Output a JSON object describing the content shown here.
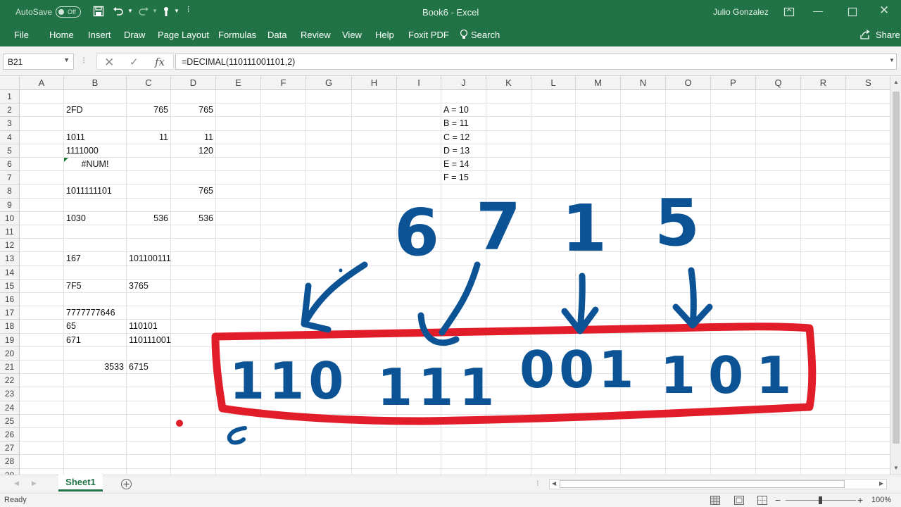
{
  "titlebar": {
    "autosave_label": "AutoSave",
    "autosave_state": "Off",
    "window_title": "Book6 - Excel",
    "user_name": "Julio Gonzalez",
    "bg_color": "#217346"
  },
  "ribbon": {
    "tabs": [
      "File",
      "Home",
      "Insert",
      "Draw",
      "Page Layout",
      "Formulas",
      "Data",
      "Review",
      "View",
      "Help",
      "Foxit PDF"
    ],
    "search_label": "Search",
    "share_label": "Share"
  },
  "formula_bar": {
    "name_box": "B21",
    "formula": "=DECIMAL(110111001101,2)",
    "fx_label": "fx"
  },
  "grid": {
    "columns": [
      "A",
      "B",
      "C",
      "D",
      "E",
      "F",
      "G",
      "H",
      "I",
      "J",
      "K",
      "L",
      "M",
      "N",
      "O",
      "P",
      "Q",
      "R",
      "S"
    ],
    "rows": [
      "1",
      "2",
      "3",
      "4",
      "5",
      "6",
      "7",
      "8",
      "9",
      "10",
      "11",
      "12",
      "13",
      "14",
      "15",
      "16",
      "17",
      "18",
      "19",
      "20",
      "21",
      "22",
      "23",
      "24",
      "25",
      "26",
      "27",
      "28",
      "29"
    ],
    "cells": [
      {
        "col": "B",
        "row": 2,
        "value": "2FD",
        "align": "left"
      },
      {
        "col": "C",
        "row": 2,
        "value": "765",
        "align": "right"
      },
      {
        "col": "D",
        "row": 2,
        "value": "765",
        "align": "right"
      },
      {
        "col": "B",
        "row": 4,
        "value": "1011",
        "align": "left"
      },
      {
        "col": "C",
        "row": 4,
        "value": "11",
        "align": "right"
      },
      {
        "col": "D",
        "row": 4,
        "value": "11",
        "align": "right"
      },
      {
        "col": "B",
        "row": 5,
        "value": "1111000",
        "align": "left"
      },
      {
        "col": "D",
        "row": 5,
        "value": "120",
        "align": "right"
      },
      {
        "col": "B",
        "row": 6,
        "value": "#NUM!",
        "align": "center"
      },
      {
        "col": "B",
        "row": 8,
        "value": "1011111101",
        "align": "left"
      },
      {
        "col": "D",
        "row": 8,
        "value": "765",
        "align": "right"
      },
      {
        "col": "B",
        "row": 10,
        "value": "1030",
        "align": "left"
      },
      {
        "col": "C",
        "row": 10,
        "value": "536",
        "align": "right"
      },
      {
        "col": "D",
        "row": 10,
        "value": "536",
        "align": "right"
      },
      {
        "col": "B",
        "row": 13,
        "value": "167",
        "align": "left"
      },
      {
        "col": "C",
        "row": 13,
        "value": "101100111",
        "align": "left"
      },
      {
        "col": "B",
        "row": 15,
        "value": "7F5",
        "align": "left"
      },
      {
        "col": "C",
        "row": 15,
        "value": "3765",
        "align": "left"
      },
      {
        "col": "B",
        "row": 17,
        "value": "7777777646",
        "align": "left"
      },
      {
        "col": "B",
        "row": 18,
        "value": "65",
        "align": "left"
      },
      {
        "col": "C",
        "row": 18,
        "value": "110101",
        "align": "left"
      },
      {
        "col": "B",
        "row": 19,
        "value": "671",
        "align": "left"
      },
      {
        "col": "C",
        "row": 19,
        "value": "110111001",
        "align": "left"
      },
      {
        "col": "B",
        "row": 21,
        "value": "3533",
        "align": "right"
      },
      {
        "col": "C",
        "row": 21,
        "value": "6715",
        "align": "left"
      },
      {
        "col": "J",
        "row": 2,
        "value": "A = 10",
        "align": "left"
      },
      {
        "col": "J",
        "row": 3,
        "value": "B = 11",
        "align": "left"
      },
      {
        "col": "J",
        "row": 4,
        "value": "C = 12",
        "align": "left"
      },
      {
        "col": "J",
        "row": 5,
        "value": "D = 13",
        "align": "left"
      },
      {
        "col": "J",
        "row": 6,
        "value": "E = 14",
        "align": "left"
      },
      {
        "col": "J",
        "row": 7,
        "value": "F = 15",
        "align": "left"
      }
    ]
  },
  "annotation": {
    "octal_digits": [
      "6",
      "7",
      "1",
      "5"
    ],
    "binary_groups": [
      "110",
      "111",
      "001",
      "101"
    ],
    "ink_blue": "#0b5394",
    "ink_red": "#e11d2a"
  },
  "sheets": {
    "tabs": [
      "Sheet1"
    ],
    "active": "Sheet1"
  },
  "status": {
    "text": "Ready",
    "zoom": "100%"
  }
}
